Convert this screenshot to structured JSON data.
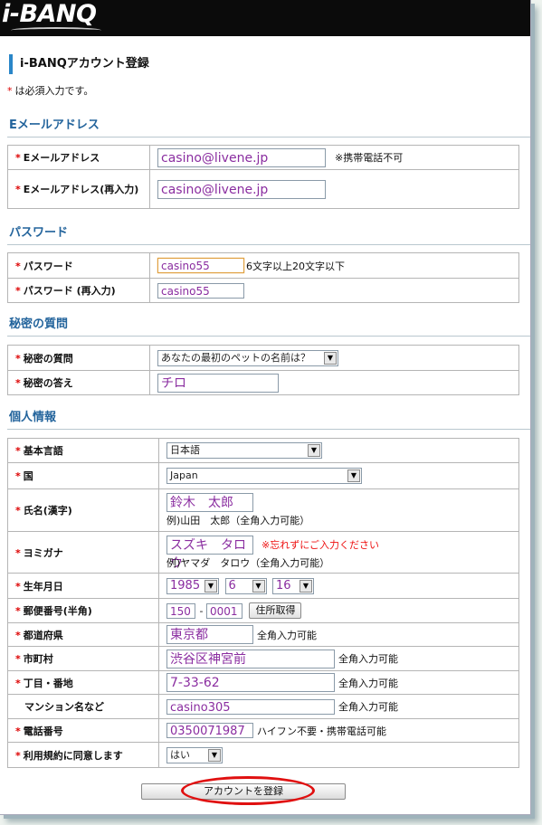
{
  "header": {
    "logo_text": "i-BANQ"
  },
  "page_title": "i-BANQアカウント登録",
  "required_note": "は必須入力です。",
  "required_mark": "*",
  "sections": {
    "email": "Eメールアドレス",
    "password": "パスワード",
    "secret": "秘密の質問",
    "personal": "個人情報"
  },
  "email": {
    "label": "Eメールアドレス",
    "value": "casino@livene.jp",
    "note": "※携帯電話不可",
    "confirm_label": "Eメールアドレス(再入力)",
    "confirm_value": "casino@livene.jp"
  },
  "password": {
    "label": "パスワード",
    "value": "casino55",
    "note": "6文字以上20文字以下",
    "confirm_label": "パスワード (再入力)",
    "confirm_value": "casino55"
  },
  "secret": {
    "question_label": "秘密の質問",
    "question_value": "あなたの最初のペットの名前は？",
    "answer_label": "秘密の答え",
    "answer_value": "チロ"
  },
  "personal": {
    "language_label": "基本言語",
    "language_value": "日本語",
    "country_label": "国",
    "country_value": "Japan",
    "name_label": "氏名(漢字)",
    "name_value": "鈴木　太郎",
    "name_example": "例)山田　太郎（全角入力可能）",
    "kana_label": "ヨミガナ",
    "kana_value": "スズキ　タロウ",
    "kana_warning": "※忘れずにご入力ください",
    "kana_example": "例)ヤマダ　タロウ（全角入力可能）",
    "birth_label": "生年月日",
    "birth_year": "1985",
    "birth_month": "6",
    "birth_day": "16",
    "postal_label": "郵便番号(半角)",
    "postal_1": "150",
    "postal_sep": "-",
    "postal_2": "0001",
    "postal_button": "住所取得",
    "pref_label": "都道府県",
    "pref_value": "東京都",
    "pref_note": "全角入力可能",
    "city_label": "市町村",
    "city_value": "渋谷区神宮前",
    "city_note": "全角入力可能",
    "street_label": "丁目・番地",
    "street_value": "7-33-62",
    "street_note": "全角入力可能",
    "building_label": "マンション名など",
    "building_value": "casino305",
    "building_note": "全角入力可能",
    "phone_label": "電話番号",
    "phone_value": "0350071987",
    "phone_note": "ハイフン不要・携帯電話可能",
    "terms_label": "利用規約に同意します",
    "terms_value": "はい"
  },
  "submit_label": "アカウントを登録",
  "colors": {
    "accent": "#23649c",
    "required": "#dd0000",
    "input_text": "#8a2da0",
    "highlight_circle": "#e01010"
  }
}
